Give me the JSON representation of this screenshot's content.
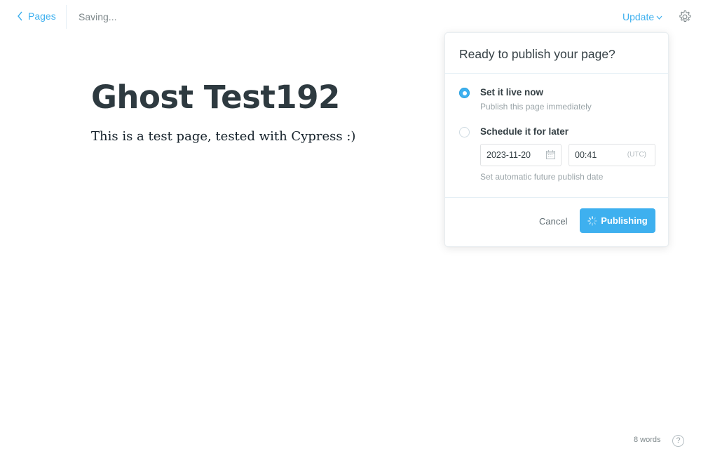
{
  "header": {
    "back_label": "Pages",
    "status": "Saving...",
    "update_label": "Update"
  },
  "editor": {
    "title": "Ghost Test192",
    "body": "This is a test page, tested with Cypress :)"
  },
  "publish_menu": {
    "heading": "Ready to publish your page?",
    "options": [
      {
        "title": "Set it live now",
        "subtitle": "Publish this page immediately",
        "selected": true
      },
      {
        "title": "Schedule it for later",
        "subtitle": "",
        "selected": false
      }
    ],
    "date_value": "2023-11-20",
    "time_value": "00:41",
    "timezone": "(UTC)",
    "hint": "Set automatic future publish date",
    "cancel_label": "Cancel",
    "publish_label": "Publishing"
  },
  "footer": {
    "word_count": "8 words",
    "help_label": "?"
  },
  "icons": {
    "back": "chevron-left-icon",
    "update_caret": "chevron-down-icon",
    "settings": "gear-icon",
    "calendar": "calendar-icon",
    "spinner": "spinner-icon"
  },
  "colors": {
    "accent": "#3eb0ef",
    "title": "#2e3a40",
    "muted": "#9aa4a8"
  }
}
